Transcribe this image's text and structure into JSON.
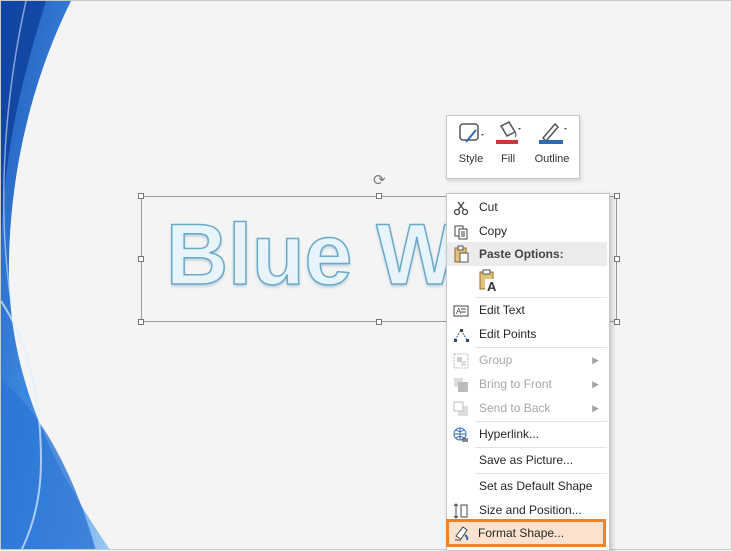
{
  "slide": {
    "text": "Blue W"
  },
  "mini_toolbar": {
    "style_label": "Style",
    "fill_label": "Fill",
    "outline_label": "Outline",
    "fill_color": "#c8373a",
    "outline_color": "#2e6bb5"
  },
  "context_menu": {
    "cut": "Cut",
    "copy": "Copy",
    "paste_options": "Paste Options:",
    "edit_text": "Edit Text",
    "edit_points": "Edit Points",
    "group": "Group",
    "bring_to_front": "Bring to Front",
    "send_to_back": "Send to Back",
    "hyperlink": "Hyperlink...",
    "save_as_picture": "Save as Picture...",
    "set_default_shape": "Set as Default Shape",
    "size_position": "Size and Position...",
    "format_shape": "Format Shape..."
  },
  "colors": {
    "highlight_border": "#f5821f",
    "highlight_fill": "#fde3cf"
  }
}
